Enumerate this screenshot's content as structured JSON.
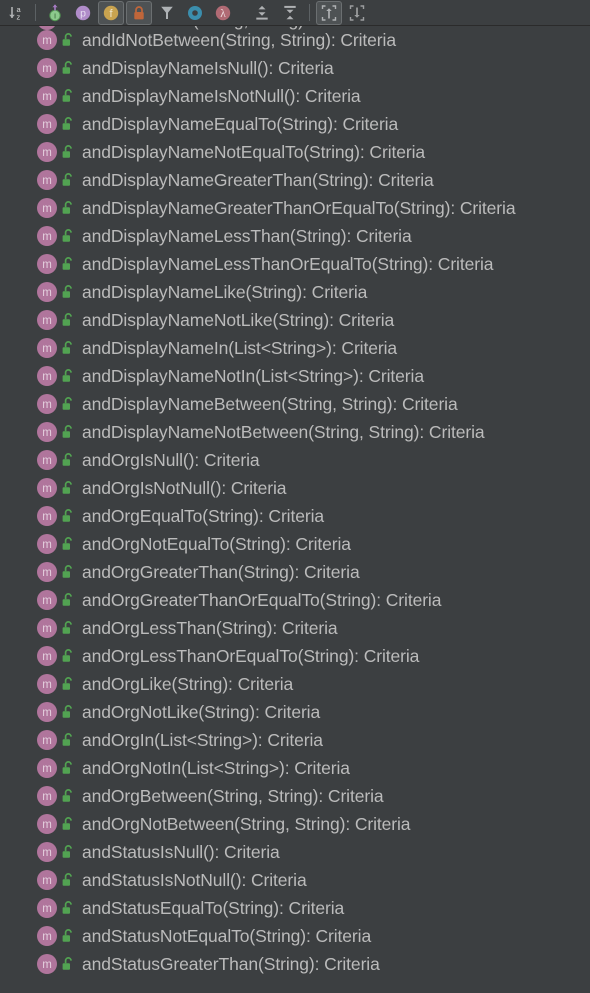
{
  "window": {
    "background_color": "#3c3f41",
    "text_color": "#bbbbbb",
    "method_icon_color": "#b0759c",
    "visibility_icon_color": "#52a352"
  },
  "toolbar": {
    "buttons": [
      {
        "name": "sort-alphabetically-button",
        "icon": "sort-alphabetically-icon",
        "label": "Sort Alphabetically",
        "pressed": false
      },
      {
        "name": "show-inherited-button",
        "icon": "inherited-members-icon",
        "label": "Show Inherited",
        "pressed": false
      },
      {
        "name": "show-properties-button",
        "icon": "property-icon",
        "label": "Show Properties",
        "pressed": false
      },
      {
        "name": "show-fields-button",
        "icon": "field-icon",
        "label": "Show Fields",
        "pressed": true
      },
      {
        "name": "show-non-public-button",
        "icon": "lock-icon",
        "label": "Show Non-Public",
        "pressed": true
      },
      {
        "name": "group-by-class-button",
        "icon": "funnel-icon",
        "label": "Group by Class",
        "pressed": false
      },
      {
        "name": "show-anonymous-classes-button",
        "icon": "anonymous-class-icon",
        "label": "Show Anonymous Classes",
        "pressed": false
      },
      {
        "name": "show-lambdas-button",
        "icon": "lambda-icon",
        "label": "Show Lambdas",
        "pressed": false
      },
      {
        "name": "expand-all-button",
        "icon": "expand-all-icon",
        "label": "Expand All",
        "pressed": false
      },
      {
        "name": "collapse-all-button",
        "icon": "collapse-all-icon",
        "label": "Collapse All",
        "pressed": false
      },
      {
        "name": "autoscroll-to-source-button",
        "icon": "autoscroll-to-source-icon",
        "label": "Autoscroll to Source",
        "pressed": true
      },
      {
        "name": "autoscroll-from-source-button",
        "icon": "autoscroll-from-source-icon",
        "label": "Autoscroll from Source",
        "pressed": false
      }
    ]
  },
  "member_list": {
    "clipped_top_row": {
      "label": "andIdBetween(String, String): Criteria",
      "method_icon": "method-icon",
      "visibility_icon": "public-unlocked-icon"
    },
    "rows": [
      {
        "label": "andIdNotBetween(String, String): Criteria",
        "method_icon": "method-icon",
        "visibility_icon": "public-unlocked-icon"
      },
      {
        "label": "andDisplayNameIsNull(): Criteria",
        "method_icon": "method-icon",
        "visibility_icon": "public-unlocked-icon"
      },
      {
        "label": "andDisplayNameIsNotNull(): Criteria",
        "method_icon": "method-icon",
        "visibility_icon": "public-unlocked-icon"
      },
      {
        "label": "andDisplayNameEqualTo(String): Criteria",
        "method_icon": "method-icon",
        "visibility_icon": "public-unlocked-icon"
      },
      {
        "label": "andDisplayNameNotEqualTo(String): Criteria",
        "method_icon": "method-icon",
        "visibility_icon": "public-unlocked-icon"
      },
      {
        "label": "andDisplayNameGreaterThan(String): Criteria",
        "method_icon": "method-icon",
        "visibility_icon": "public-unlocked-icon"
      },
      {
        "label": "andDisplayNameGreaterThanOrEqualTo(String): Criteria",
        "method_icon": "method-icon",
        "visibility_icon": "public-unlocked-icon"
      },
      {
        "label": "andDisplayNameLessThan(String): Criteria",
        "method_icon": "method-icon",
        "visibility_icon": "public-unlocked-icon"
      },
      {
        "label": "andDisplayNameLessThanOrEqualTo(String): Criteria",
        "method_icon": "method-icon",
        "visibility_icon": "public-unlocked-icon"
      },
      {
        "label": "andDisplayNameLike(String): Criteria",
        "method_icon": "method-icon",
        "visibility_icon": "public-unlocked-icon"
      },
      {
        "label": "andDisplayNameNotLike(String): Criteria",
        "method_icon": "method-icon",
        "visibility_icon": "public-unlocked-icon"
      },
      {
        "label": "andDisplayNameIn(List<String>): Criteria",
        "method_icon": "method-icon",
        "visibility_icon": "public-unlocked-icon"
      },
      {
        "label": "andDisplayNameNotIn(List<String>): Criteria",
        "method_icon": "method-icon",
        "visibility_icon": "public-unlocked-icon"
      },
      {
        "label": "andDisplayNameBetween(String, String): Criteria",
        "method_icon": "method-icon",
        "visibility_icon": "public-unlocked-icon"
      },
      {
        "label": "andDisplayNameNotBetween(String, String): Criteria",
        "method_icon": "method-icon",
        "visibility_icon": "public-unlocked-icon"
      },
      {
        "label": "andOrgIsNull(): Criteria",
        "method_icon": "method-icon",
        "visibility_icon": "public-unlocked-icon"
      },
      {
        "label": "andOrgIsNotNull(): Criteria",
        "method_icon": "method-icon",
        "visibility_icon": "public-unlocked-icon"
      },
      {
        "label": "andOrgEqualTo(String): Criteria",
        "method_icon": "method-icon",
        "visibility_icon": "public-unlocked-icon"
      },
      {
        "label": "andOrgNotEqualTo(String): Criteria",
        "method_icon": "method-icon",
        "visibility_icon": "public-unlocked-icon"
      },
      {
        "label": "andOrgGreaterThan(String): Criteria",
        "method_icon": "method-icon",
        "visibility_icon": "public-unlocked-icon"
      },
      {
        "label": "andOrgGreaterThanOrEqualTo(String): Criteria",
        "method_icon": "method-icon",
        "visibility_icon": "public-unlocked-icon"
      },
      {
        "label": "andOrgLessThan(String): Criteria",
        "method_icon": "method-icon",
        "visibility_icon": "public-unlocked-icon"
      },
      {
        "label": "andOrgLessThanOrEqualTo(String): Criteria",
        "method_icon": "method-icon",
        "visibility_icon": "public-unlocked-icon"
      },
      {
        "label": "andOrgLike(String): Criteria",
        "method_icon": "method-icon",
        "visibility_icon": "public-unlocked-icon"
      },
      {
        "label": "andOrgNotLike(String): Criteria",
        "method_icon": "method-icon",
        "visibility_icon": "public-unlocked-icon"
      },
      {
        "label": "andOrgIn(List<String>): Criteria",
        "method_icon": "method-icon",
        "visibility_icon": "public-unlocked-icon"
      },
      {
        "label": "andOrgNotIn(List<String>): Criteria",
        "method_icon": "method-icon",
        "visibility_icon": "public-unlocked-icon"
      },
      {
        "label": "andOrgBetween(String, String): Criteria",
        "method_icon": "method-icon",
        "visibility_icon": "public-unlocked-icon"
      },
      {
        "label": "andOrgNotBetween(String, String): Criteria",
        "method_icon": "method-icon",
        "visibility_icon": "public-unlocked-icon"
      },
      {
        "label": "andStatusIsNull(): Criteria",
        "method_icon": "method-icon",
        "visibility_icon": "public-unlocked-icon"
      },
      {
        "label": "andStatusIsNotNull(): Criteria",
        "method_icon": "method-icon",
        "visibility_icon": "public-unlocked-icon"
      },
      {
        "label": "andStatusEqualTo(String): Criteria",
        "method_icon": "method-icon",
        "visibility_icon": "public-unlocked-icon"
      },
      {
        "label": "andStatusNotEqualTo(String): Criteria",
        "method_icon": "method-icon",
        "visibility_icon": "public-unlocked-icon"
      },
      {
        "label": "andStatusGreaterThan(String): Criteria",
        "method_icon": "method-icon",
        "visibility_icon": "public-unlocked-icon"
      }
    ]
  }
}
